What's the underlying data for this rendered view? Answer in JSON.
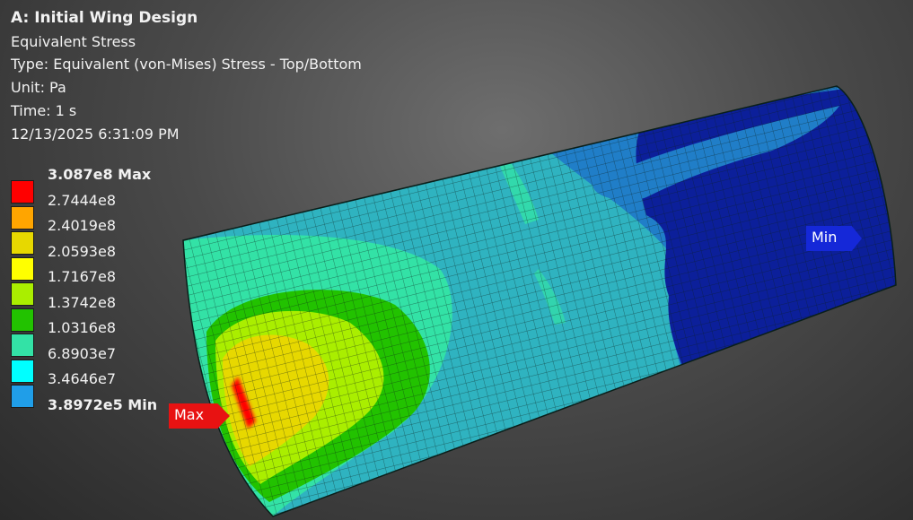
{
  "header": {
    "title": "A: Initial Wing Design",
    "result_name": "Equivalent Stress",
    "type_line": "Type: Equivalent (von-Mises) Stress - Top/Bottom",
    "unit_line": "Unit: Pa",
    "time_line": "Time: 1 s",
    "timestamp": "12/13/2025 6:31:09 PM"
  },
  "legend": {
    "entries": [
      {
        "label": "3.087e8 Max",
        "color": "#ff0000",
        "bold": true
      },
      {
        "label": "2.7444e8",
        "color": "#ffa500",
        "bold": false
      },
      {
        "label": "2.4019e8",
        "color": "#e7d800",
        "bold": false
      },
      {
        "label": "2.0593e8",
        "color": "#ffff00",
        "bold": false
      },
      {
        "label": "1.7167e8",
        "color": "#aaee00",
        "bold": false
      },
      {
        "label": "1.3742e8",
        "color": "#22c200",
        "bold": false
      },
      {
        "label": "1.0316e8",
        "color": "#33e2a6",
        "bold": false
      },
      {
        "label": "6.8903e7",
        "color": "#00ffff",
        "bold": false
      },
      {
        "label": "3.4646e7",
        "color": "#209ee8",
        "bold": false
      },
      {
        "label": "3.8972e5 Min",
        "color": "#0000e8",
        "bold": true
      }
    ]
  },
  "probes": {
    "max_label": "Max",
    "min_label": "Min"
  },
  "colors": {
    "background": "#4a4a4a",
    "mesh_line": "#0a1f1a",
    "max_tag": "#e81212",
    "min_tag": "#1528d8"
  }
}
